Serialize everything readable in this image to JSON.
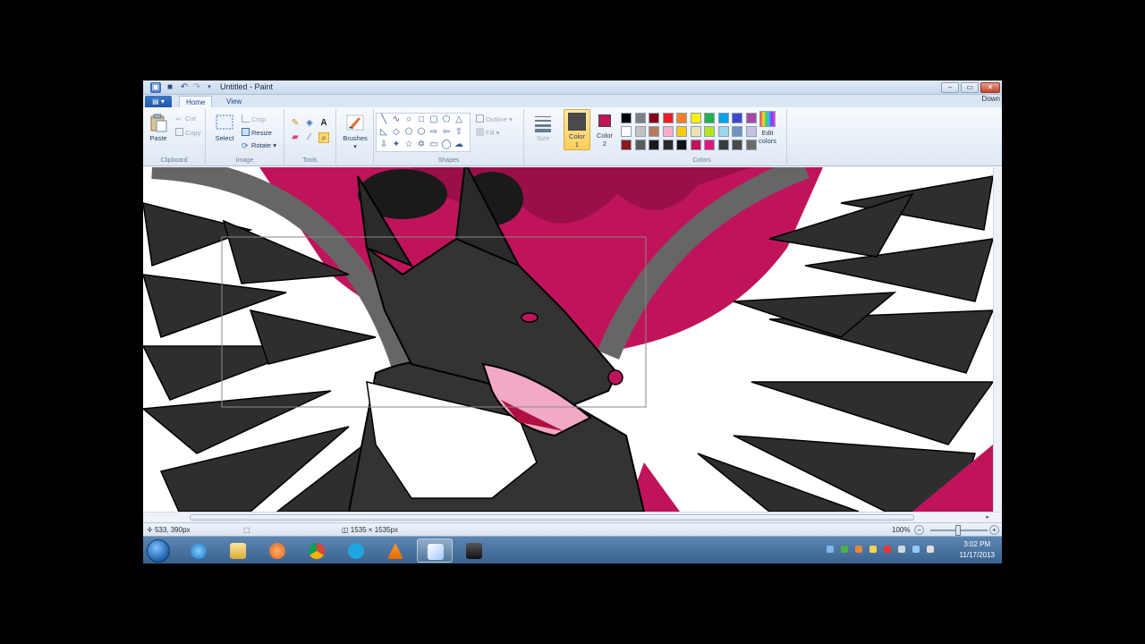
{
  "window": {
    "title": "Untitled - Paint",
    "corner_text": "Down"
  },
  "ribbon": {
    "app_menu_label": "▾",
    "tabs": [
      {
        "label": "Home"
      },
      {
        "label": "View"
      }
    ],
    "clipboard": {
      "paste": "Paste",
      "cut": "Cut",
      "copy": "Copy",
      "group_label": "Clipboard"
    },
    "image": {
      "select": "Select",
      "crop": "Crop",
      "resize": "Resize",
      "rotate": "Rotate",
      "group_label": "Image"
    },
    "tools": {
      "group_label": "Tools"
    },
    "brushes": {
      "label": "Brushes"
    },
    "shapes": {
      "outline": "Outline",
      "fill": "Fill",
      "group_label": "Shapes"
    },
    "size": {
      "label": "Size"
    },
    "color1": {
      "label_top": "Color",
      "label_bottom": "1",
      "value": "#4a4a4a"
    },
    "color2": {
      "label_top": "Color",
      "label_bottom": "2",
      "value": "#c0145a"
    },
    "colors": {
      "group_label": "Colors",
      "edit_label_top": "Edit",
      "edit_label_bottom": "colors",
      "palette": [
        "#000000",
        "#7f7f7f",
        "#880015",
        "#ed1c24",
        "#ff7f27",
        "#fff200",
        "#22b14c",
        "#00a2e8",
        "#3f48cc",
        "#a349a4",
        "#ffffff",
        "#c3c3c3",
        "#b97a57",
        "#ffaec9",
        "#ffc90e",
        "#efe4b0",
        "#b5e61d",
        "#99d9ea",
        "#7092be",
        "#c8bfe7",
        "#8b1a1a",
        "#5a5a5a",
        "#1a1a1a",
        "#2a2a2a",
        "#111111",
        "#c0145a",
        "#e0157a",
        "#3a3a3a",
        "#4a4a4a",
        "#6a6a6a"
      ]
    }
  },
  "status": {
    "cursor": "533, 390px",
    "image_size": "1535 × 1535px",
    "zoom": "100%"
  },
  "taskbar": {
    "time": "3:02 PM",
    "date": "11/17/2013"
  }
}
